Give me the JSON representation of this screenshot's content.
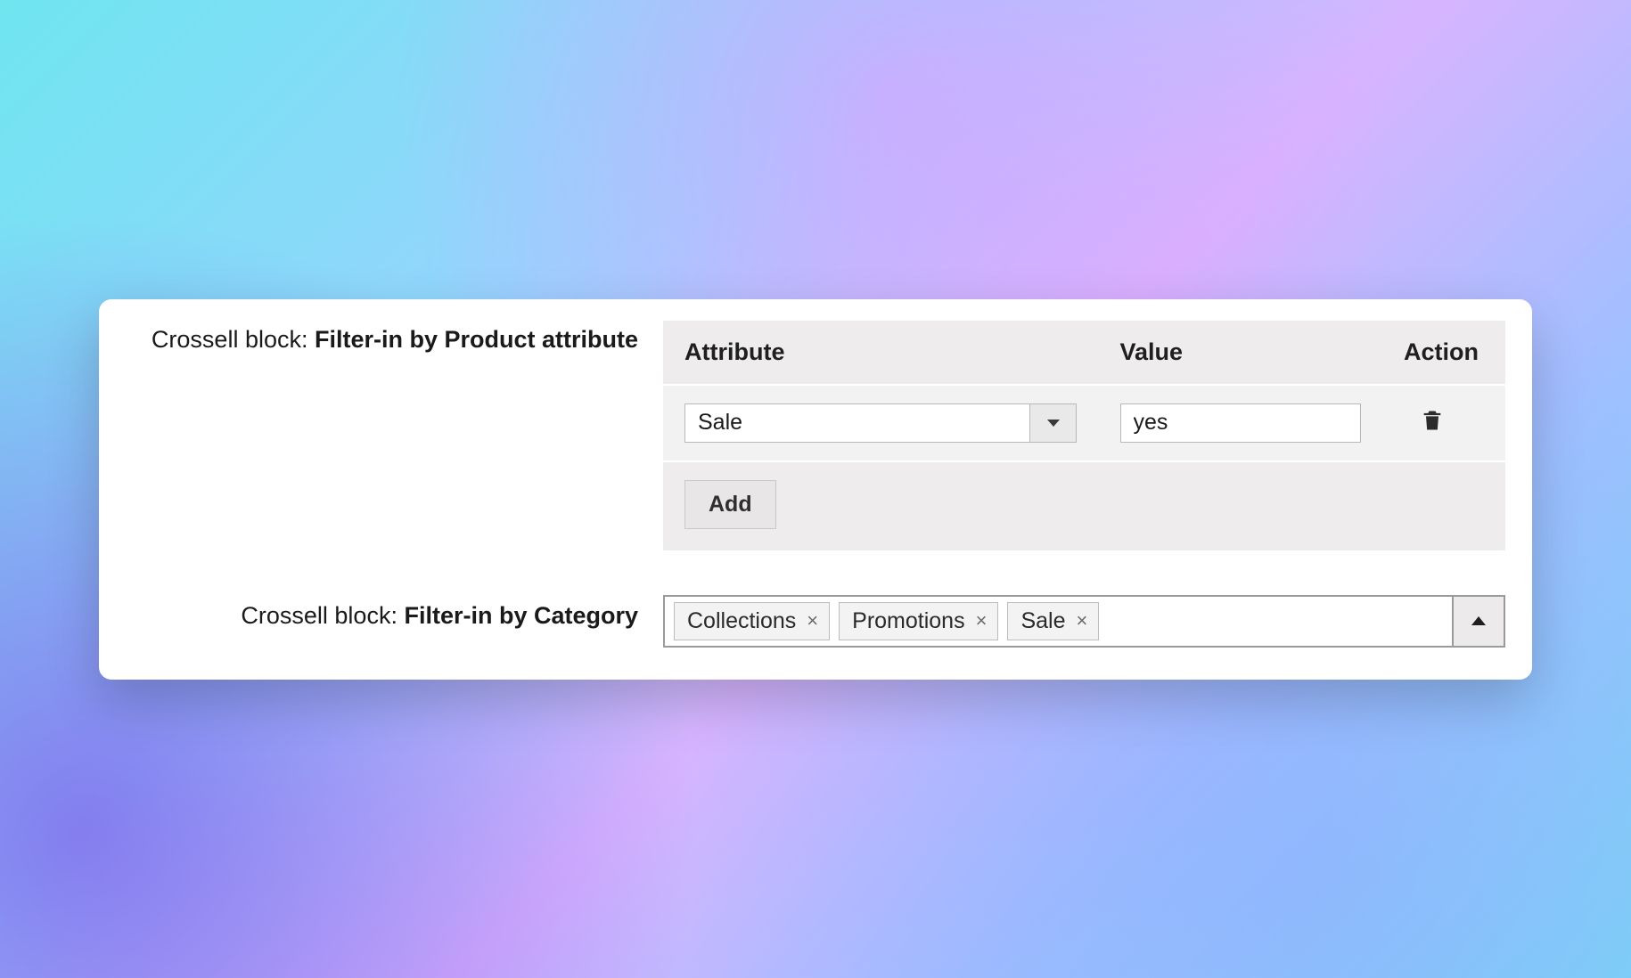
{
  "attr_section": {
    "label_prefix": "Crossell block: ",
    "label_strong": "Filter-in by Product attribute",
    "headers": {
      "attribute": "Attribute",
      "value": "Value",
      "action": "Action"
    },
    "rows": [
      {
        "attribute": "Sale",
        "value": "yes"
      }
    ],
    "add_label": "Add"
  },
  "category_section": {
    "label_prefix": "Crossell block: ",
    "label_strong": "Filter-in by Category",
    "tags": [
      "Collections",
      "Promotions",
      "Sale"
    ]
  }
}
